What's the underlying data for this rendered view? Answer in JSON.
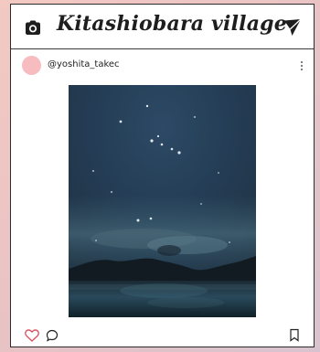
{
  "header": {
    "title": "Kitashiobara village",
    "left_icon": "camera-icon",
    "right_icon": "send-icon"
  },
  "post": {
    "username": "@yoshita_takec",
    "menu_icon": "more-vertical-icon",
    "photo_subject": "starry night sky over lake"
  },
  "actions": {
    "like_icon": "heart-icon",
    "comment_icon": "comment-icon",
    "save_icon": "bookmark-icon"
  },
  "colors": {
    "background_start": "#f3c9c2",
    "background_end": "#d7c3cf",
    "card_border": "#2d2d2d",
    "avatar": "#f6bcbf",
    "heart_stroke": "#d94f5c"
  }
}
